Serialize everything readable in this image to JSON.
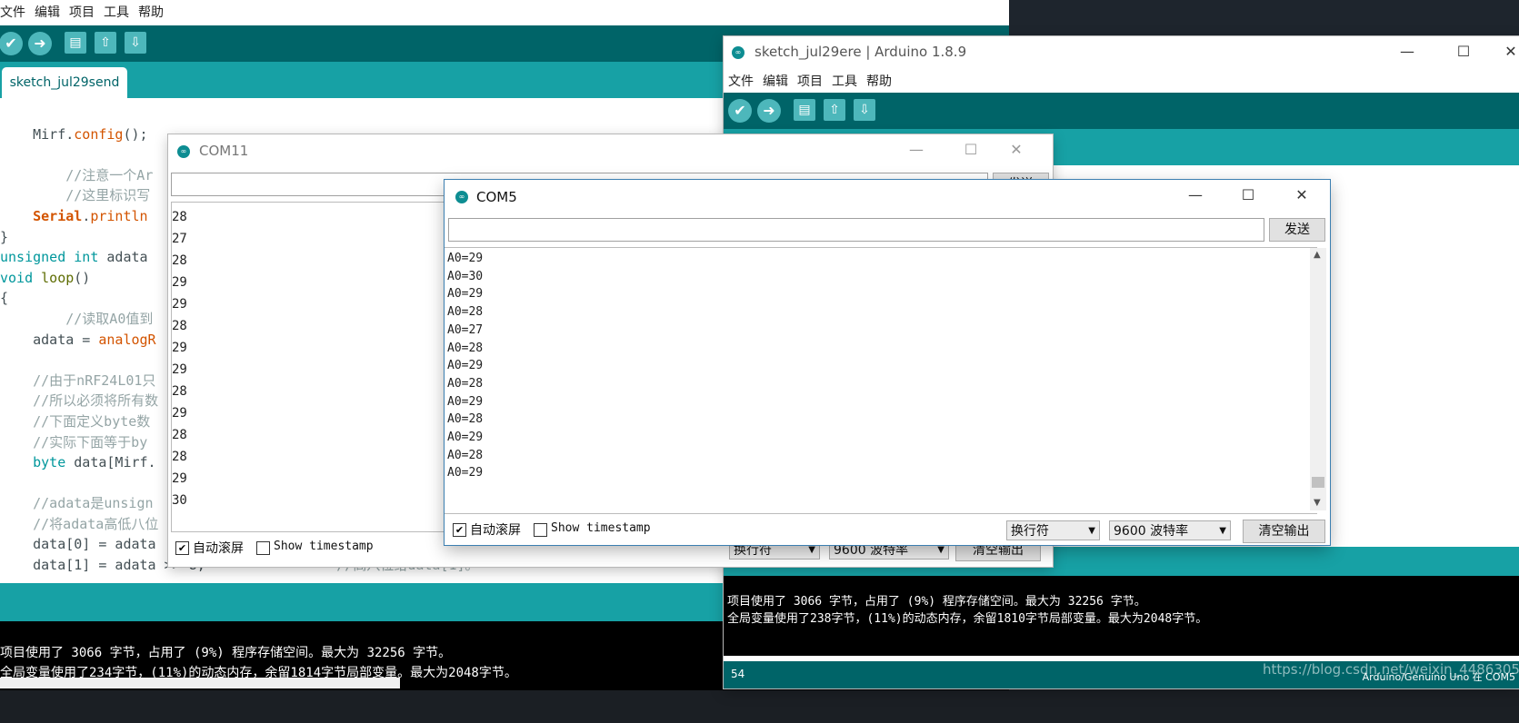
{
  "colors": {
    "toolbar": "#006468",
    "tabbar": "#17a1a5",
    "accent": "#4db7bb",
    "comment": "#95a5a6",
    "keyword": "#00979c",
    "function": "#d35400"
  },
  "left_ide": {
    "menu": [
      "文件",
      "编辑",
      "项目",
      "工具",
      "帮助"
    ],
    "toolbar_icons": [
      "verify-icon",
      "upload-icon",
      "new-icon",
      "open-icon",
      "save-icon"
    ],
    "tab": "sketch_jul29send",
    "code": {
      "l1a": "    Mirf.",
      "l1b": "config",
      "l1c": "();",
      "l2": "        //注意一个Ar",
      "l3": "        //这里标识写",
      "l4a": "    ",
      "l4b": "Serial",
      "l4c": ".",
      "l4d": "println",
      "l5": "}",
      "l6a": "unsigned int",
      "l6b": " adata",
      "l7a": "void",
      "l7b": " ",
      "l7c": "loop",
      "l7d": "()",
      "l8": "{",
      "l9": "        //读取A0值到",
      "l10a": "    adata = ",
      "l10b": "analogR",
      "l11": "    //由于nRF24L01只",
      "l12": "    //所以必须将所有数",
      "l13": "    //下面定义byte数",
      "l14": "    //实际下面等于by",
      "l15a": "    ",
      "l15b": "byte",
      "l15c": " data[Mirf.",
      "l16": "    //adata是unsign",
      "l17": "    //将adata高低八位",
      "l18": "    data[0] = adata",
      "l19a": "    data[1] = adata >> 8;",
      "l19b": "                //高八位给data[1]。"
    },
    "console": [
      "项目使用了 3066 字节，占用了 (9%) 程序存储空间。最大为 32256 字节。",
      "全局变量使用了234字节，(11%)的动态内存，余留1814字节局部变量。最大为2048字节。"
    ]
  },
  "right_ide": {
    "title": "sketch_jul29ere | Arduino 1.8.9",
    "menu": [
      "文件",
      "编辑",
      "项目",
      "工具",
      "帮助"
    ],
    "console": [
      "项目使用了 3066 字节，占用了 (9%) 程序存储空间。最大为 32256 字节。",
      "全局变量使用了238字节，(11%)的动态内存，余留1810字节局部变量。最大为2048字节。"
    ],
    "status_line": "54",
    "board": "Arduino/Genuino Uno 在 COM5"
  },
  "com11": {
    "title": "COM11",
    "send": "发送",
    "values": [
      "28",
      "27",
      "28",
      "29",
      "29",
      "28",
      "29",
      "29",
      "28",
      "29",
      "28",
      "28",
      "29",
      "30"
    ],
    "autoscroll": "自动滚屏",
    "timestamp": "Show timestamp",
    "line_ending": "换行符",
    "baud": "9600 波特率",
    "clear": "清空输出"
  },
  "com5": {
    "title": "COM5",
    "send": "发送",
    "values": [
      "A0=29",
      "A0=30",
      "A0=29",
      "A0=28",
      "A0=27",
      "A0=28",
      "A0=29",
      "A0=28",
      "A0=29",
      "A0=28",
      "A0=29",
      "A0=28",
      "A0=29"
    ],
    "autoscroll": "自动滚屏",
    "timestamp": "Show timestamp",
    "line_ending": "换行符",
    "baud": "9600 波特率",
    "clear": "清空输出"
  },
  "watermark": "https://blog.csdn.net/weixin_44863057"
}
